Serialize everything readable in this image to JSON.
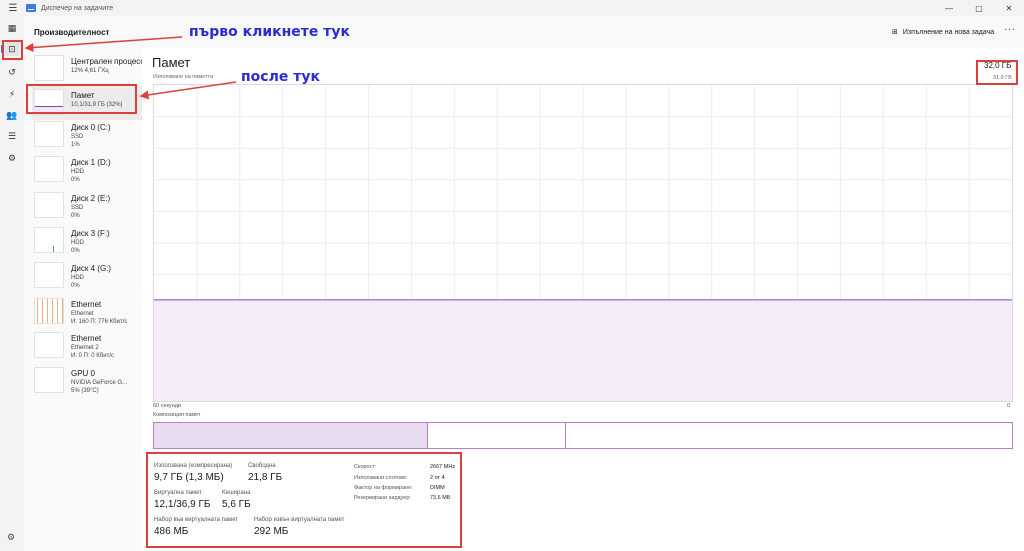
{
  "window": {
    "title": "Диспечер на задачите",
    "minimize_icon": "minimize-icon",
    "maximize_icon": "maximize-icon",
    "close_icon": "close-icon"
  },
  "header": {
    "page_title": "Производителност",
    "new_task_label": "Изпълнение на нова задача",
    "more_label": "···"
  },
  "rail": {
    "icons": [
      "hamburger-icon",
      "processes-icon",
      "performance-icon",
      "app-history-icon",
      "startup-apps-icon",
      "users-icon",
      "details-icon",
      "services-icon",
      "settings-icon"
    ]
  },
  "resources": [
    {
      "name": "Централен процесор",
      "sub1": "12% 4,61 ГХц",
      "sub2": ""
    },
    {
      "name": "Памет",
      "sub1": "10,1/31,9 ГБ (32%)",
      "sub2": ""
    },
    {
      "name": "Диск 0 (C:)",
      "sub1": "SSD",
      "sub2": "1%"
    },
    {
      "name": "Диск 1 (D:)",
      "sub1": "HDD",
      "sub2": "0%"
    },
    {
      "name": "Диск 2 (E:)",
      "sub1": "SSD",
      "sub2": "0%"
    },
    {
      "name": "Диск 3 (F:)",
      "sub1": "HDD",
      "sub2": "0%"
    },
    {
      "name": "Диск 4 (G:)",
      "sub1": "HDD",
      "sub2": "0%"
    },
    {
      "name": "Ethernet",
      "sub1": "Ethernet",
      "sub2": "И: 160 П: 776 Кбит/с"
    },
    {
      "name": "Ethernet",
      "sub1": "Ethernet 2",
      "sub2": "И: 0 П: 0 Кбит/с"
    },
    {
      "name": "GPU 0",
      "sub1": "NVIDIA GeForce G...",
      "sub2": "5% (39°C)"
    }
  ],
  "memory": {
    "title": "Памет",
    "usage_label": "Използване на паметта",
    "total": "32,0 ГБ",
    "graph_max": "31,9 ГБ",
    "axis_left": "60 секунди",
    "axis_right": "0",
    "composition_label": "Композиция памет",
    "usage_fraction": 0.32,
    "color": "#8e44ad"
  },
  "stats": {
    "in_use_label": "Използвана (компресирана)",
    "in_use_value": "9,7 ГБ (1,3 МБ)",
    "available_label": "Свободна",
    "available_value": "21,8 ГБ",
    "committed_label": "Виртуална памет",
    "committed_value": "12,1/36,9 ГБ",
    "cached_label": "Кеширана",
    "cached_value": "5,6 ГБ",
    "paged_label": "Набор във виртуалната памет",
    "paged_value": "486 МБ",
    "nonpaged_label": "Набор извън виртуалната памет",
    "nonpaged_value": "292 МБ",
    "details": [
      {
        "k": "Скорост:",
        "v": "2667 MHz"
      },
      {
        "k": "Използвани слотове:",
        "v": "2 от 4"
      },
      {
        "k": "Фактор на формиране:",
        "v": "DIMM"
      },
      {
        "k": "Резервирани хардуер:",
        "v": "73,6 МБ"
      }
    ]
  },
  "annotations": {
    "first": "първо кликнете тук",
    "then": "после тук"
  },
  "colors": {
    "accent": "#2f6fc7",
    "annotation_red": "#d9413a",
    "annotation_text": "#2b2bd6"
  }
}
